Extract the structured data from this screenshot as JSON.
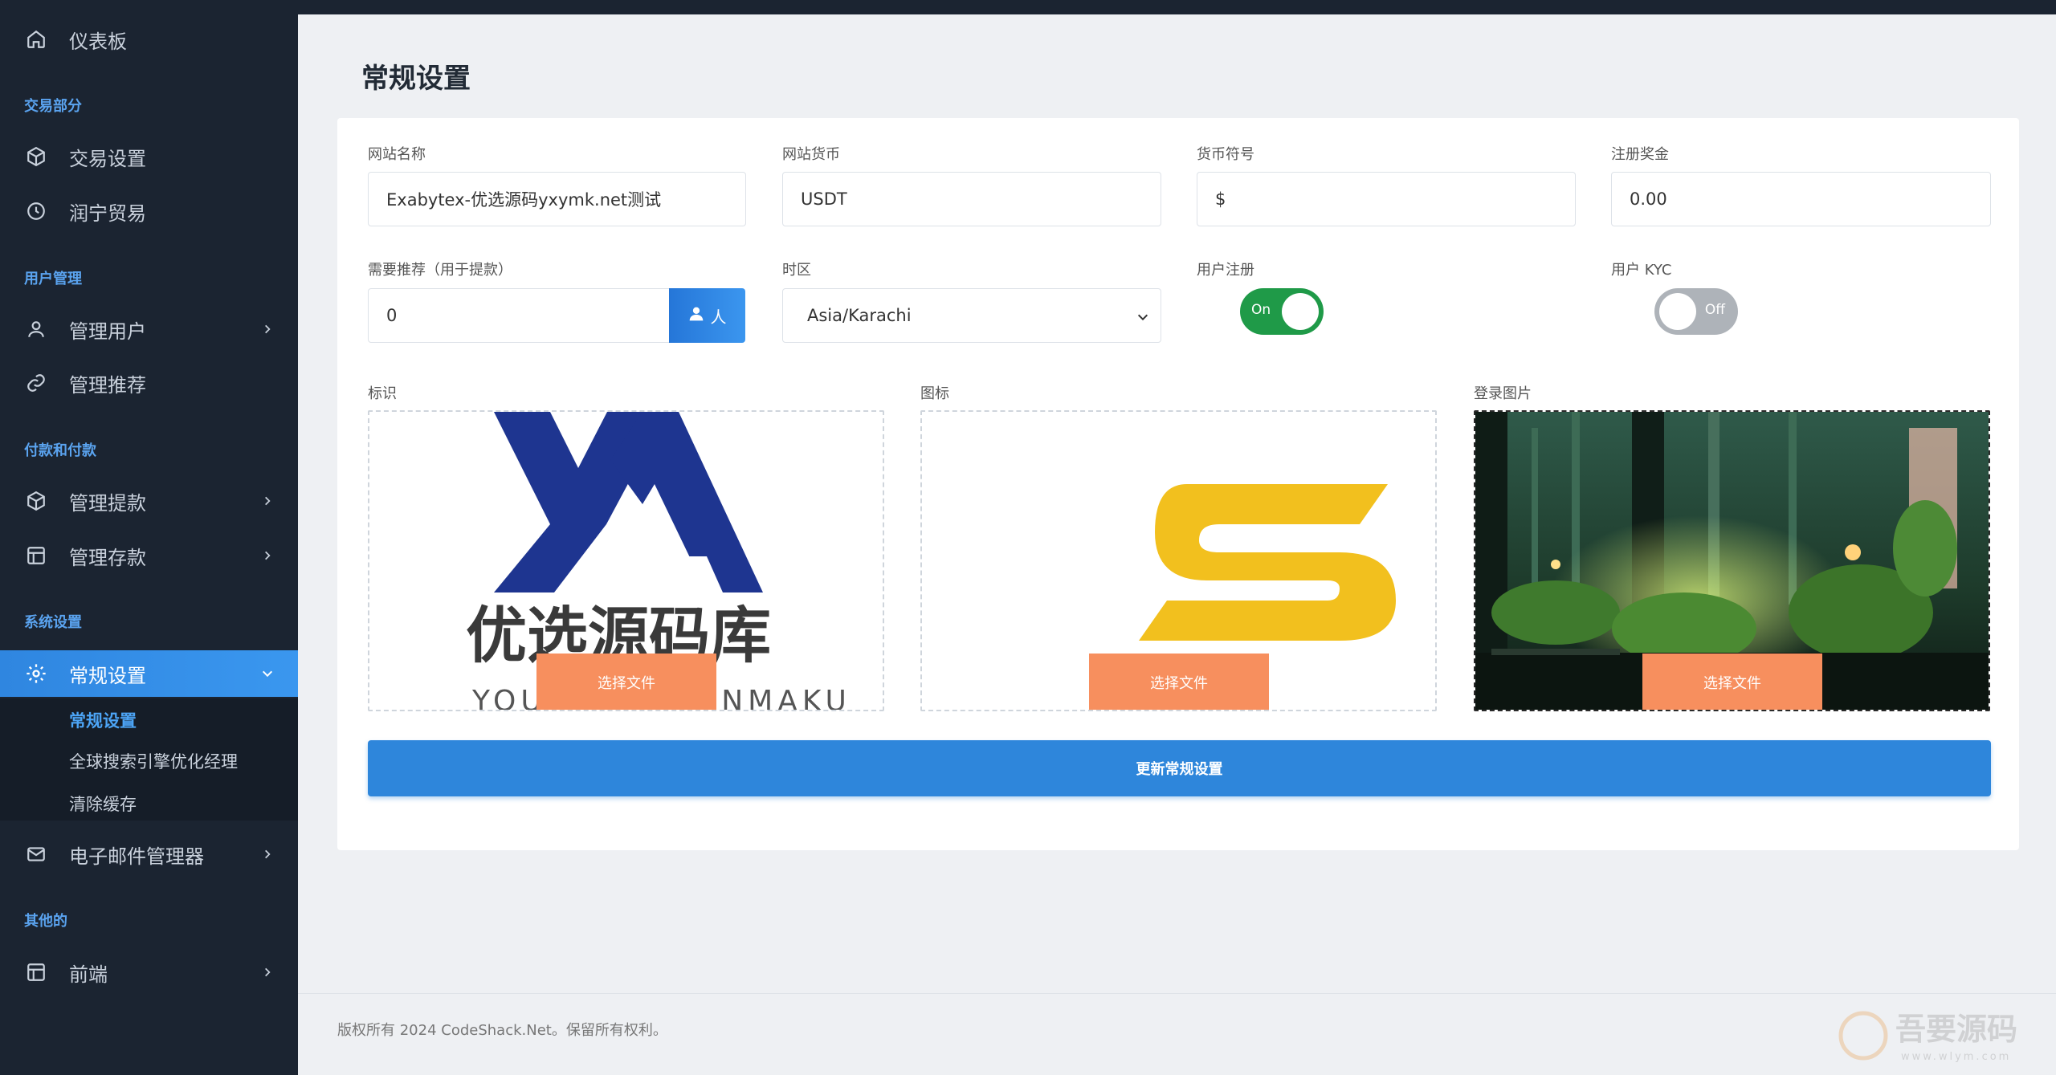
{
  "sidebar": {
    "dashboard": "仪表板",
    "sections": {
      "trade": "交易部分",
      "users": "用户管理",
      "payments": "付款和付款",
      "system": "系统设置",
      "other": "其他的"
    },
    "items": {
      "trade_settings": "交易设置",
      "runing_trade": "润宁贸易",
      "manage_users": "管理用户",
      "manage_referrals": "管理推荐",
      "manage_withdrawals": "管理提款",
      "manage_deposits": "管理存款",
      "general_settings": "常规设置",
      "email_manager": "电子邮件管理器",
      "frontend": "前端"
    },
    "subitems": {
      "general": "常规设置",
      "seo": "全球搜索引擎优化经理",
      "clear_cache": "清除缓存"
    }
  },
  "page": {
    "title": "常规设置"
  },
  "form": {
    "site_name": {
      "label": "网站名称",
      "value": "Exabytex-优选源码yxymk.net测试"
    },
    "site_currency": {
      "label": "网站货币",
      "value": "USDT"
    },
    "currency_symbol": {
      "label": "货币符号",
      "value": "$"
    },
    "register_bonus": {
      "label": "注册奖金",
      "value": "0.00"
    },
    "referral_needed": {
      "label": "需要推荐（用于提款）",
      "value": "0",
      "addon": "人"
    },
    "timezone": {
      "label": "时区",
      "value": "Asia/Karachi"
    },
    "user_registration": {
      "label": "用户注册",
      "state": "On"
    },
    "user_kyc": {
      "label": "用户 KYC",
      "state": "Off"
    },
    "logo": {
      "label": "标识",
      "button": "选择文件",
      "logo_text": "优选源码库",
      "logo_sub": "YOUXUANYUANMAKU"
    },
    "favicon": {
      "label": "图标",
      "button": "选择文件"
    },
    "login_image": {
      "label": "登录图片",
      "button": "选择文件"
    },
    "submit": "更新常规设置"
  },
  "footer": {
    "copyright": "版权所有 2024 CodeShack.Net。保留所有权利。"
  },
  "watermark": {
    "text": "吾要源码",
    "sub": "www.wlym.com"
  },
  "colors": {
    "sidebar_bg": "#1b2431",
    "accent": "#2e86db",
    "toggle_on": "#1f9a48",
    "choose_btn": "#f78f5e"
  }
}
